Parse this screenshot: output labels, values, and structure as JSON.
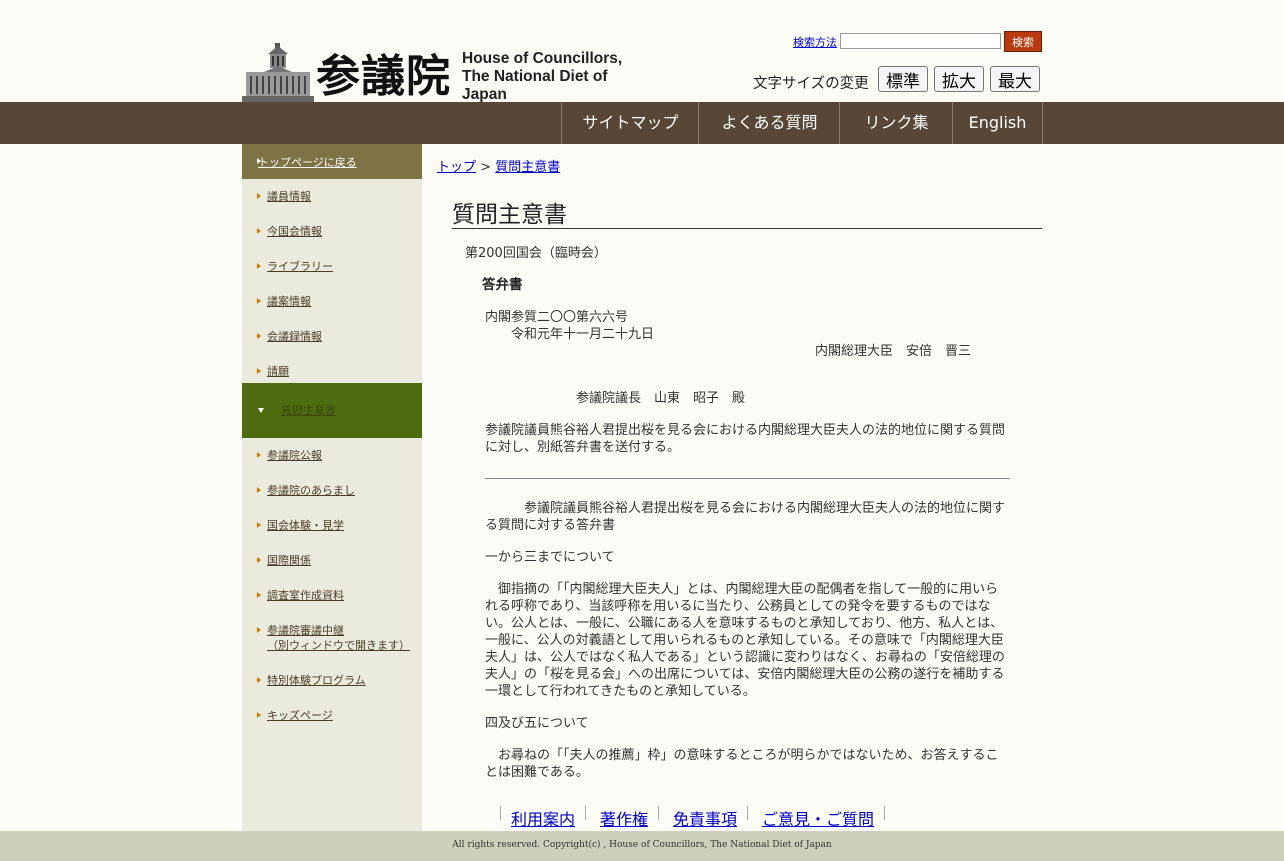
{
  "header": {
    "logo_kanji": "参議院",
    "logo_en_line1": "House of Councillors,",
    "logo_en_line2": "The National Diet of Japan",
    "search_help_link": "検索方法",
    "search_input_value": "",
    "search_button": "検索",
    "fontsize_label": "文字サイズの変更",
    "fontsize_buttons": [
      "標準",
      "拡大",
      "最大"
    ]
  },
  "nav": {
    "items": [
      "サイトマップ",
      "よくある質問",
      "リンク集",
      "English"
    ]
  },
  "sidebar": {
    "back_to_top": "トップページに戻る",
    "items": [
      "議員情報",
      "今国会情報",
      "ライブラリー",
      "議案情報",
      "会議録情報",
      "請願",
      "質問主意書",
      "参議院公報",
      "参議院のあらまし",
      "国会体験・見学",
      "国際関係",
      "調査室作成資料",
      "参議院審議中継",
      "（別ウィンドウで開きます）",
      "特別体験プログラム",
      "キッズページ"
    ]
  },
  "breadcrumb": {
    "top": "トップ",
    "sep": ">",
    "current": "質問主意書"
  },
  "main": {
    "title": "質問主意書",
    "session": "第200回国会（臨時会）",
    "doc_type": "答弁書",
    "doc_no": "内閣参質二〇〇第六六号",
    "date": "令和元年十一月二十九日",
    "sender": "内閣総理大臣　安倍　晋三",
    "recipient": "参議院議長　山東　昭子　殿",
    "cover_text": "参議院議員熊谷裕人君提出桜を見る会における内閣総理大臣夫人の法的地位に関する質問に対し、別紙答弁書を送付する。",
    "answer_title": "　　　参議院議員熊谷裕人君提出桜を見る会における内閣総理大臣夫人の法的地位に関する質問に対する答弁書",
    "section1_heading": "一から三までについて",
    "section1_body": "　御指摘の「「内閣総理大臣夫人」とは、内閣総理大臣の配偶者を指して一般的に用いられる呼称であり、当該呼称を用いるに当たり、公務員としての発令を要するものではない。公人とは、一般に、公職にある人を意味するものと承知しており、他方、私人とは、一般に、公人の対義語として用いられるものと承知している。その意味で「内閣総理大臣夫人」は、公人ではなく私人である」という認識に変わりはなく、お尋ねの「安倍総理の夫人」の「桜を見る会」への出席については、安倍内閣総理大臣の公務の遂行を補助する一環として行われてきたものと承知している。",
    "section2_heading": "四及び五について",
    "section2_body": "　お尋ねの「「夫人の推薦」枠」の意味するところが明らかではないため、お答えすることは困難である。"
  },
  "footer": {
    "links": [
      "利用案内",
      "著作権",
      "免責事項",
      "ご意見・ご質問"
    ],
    "copyright": "All rights reserved. Copyright(c) , House of Councillors, The National Diet of Japan"
  },
  "colors": {
    "nav_bg": "#584736",
    "sidebar_bg": "#ebebdd",
    "sidebar_active": "#4e6b0f",
    "search_button": "#b83a0c",
    "page_bg": "#fbfcf5"
  }
}
